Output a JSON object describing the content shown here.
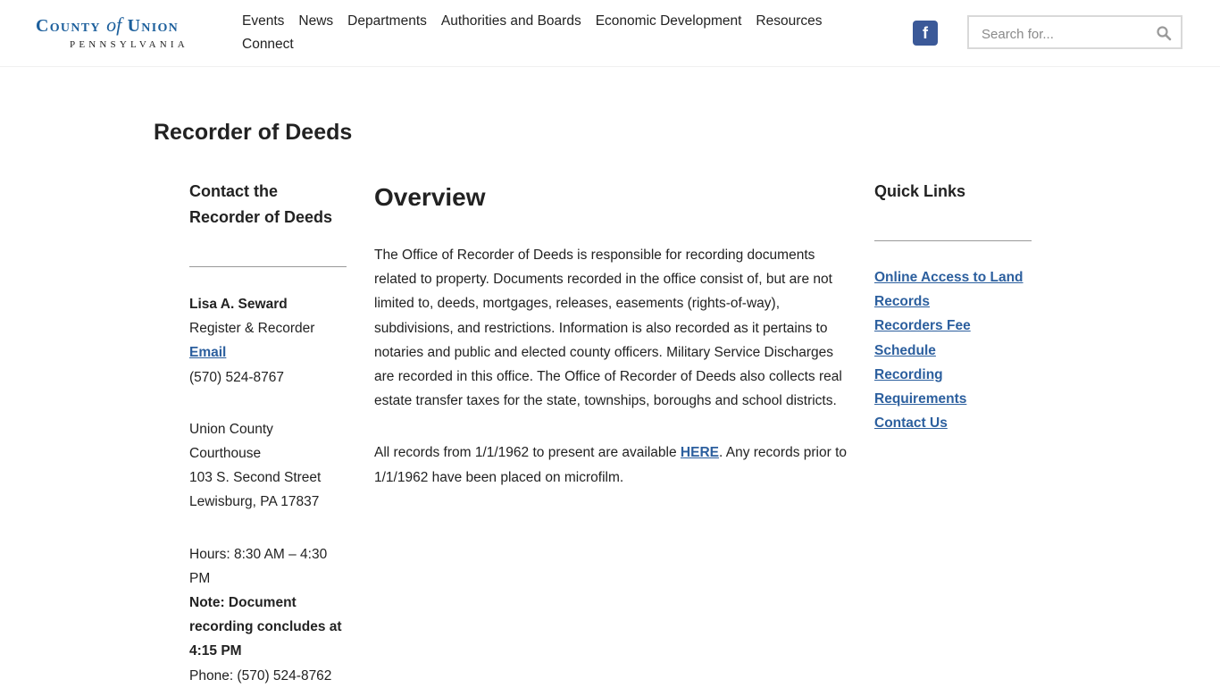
{
  "header": {
    "logo": {
      "county": "County",
      "of": "of",
      "union": "Union",
      "state": "PENNSYLVANIA"
    },
    "nav": [
      "Events",
      "News",
      "Departments",
      "Authorities and Boards",
      "Economic Development",
      "Resources",
      "Connect"
    ],
    "social": {
      "icon": "facebook-icon",
      "label": "f",
      "color": "#3b5998"
    },
    "search": {
      "placeholder": "Search for...",
      "icon": "search-icon"
    }
  },
  "page": {
    "title": "Recorder of Deeds"
  },
  "contact": {
    "heading": "Contact the Recorder of Deeds",
    "name": "Lisa A. Seward",
    "role": "Register & Recorder",
    "email_link": "Email",
    "phone_direct": "(570) 524-8767",
    "address": [
      "Union County Courthouse",
      "103 S. Second Street",
      "Lewisburg, PA 17837"
    ],
    "hours": "Hours: 8:30 AM – 4:30 PM",
    "note": "Note: Document recording concludes at 4:15 PM",
    "phone": "Phone: (570) 524-8762"
  },
  "overview": {
    "heading": "Overview",
    "paragraph1": "The Office of Recorder of Deeds is responsible for recording documents related to property. Documents recorded in the office consist of, but are not limited to, deeds, mortgages, releases, easements (rights-of-way), subdivisions, and restrictions. Information is also recorded as it pertains to notaries and public and elected county officers. Military Service Discharges are recorded in this office. The Office of Recorder of Deeds also collects real estate transfer taxes for the state, townships, boroughs and school districts.",
    "paragraph2_before": "All records from 1/1/1962 to present are available ",
    "paragraph2_link": "HERE",
    "paragraph2_after": ". Any records prior to 1/1/1962 have been placed on microfilm."
  },
  "quick_links": {
    "heading": "Quick Links",
    "items": [
      "Online Access to Land Records",
      "Recorders Fee Schedule",
      "Recording Requirements",
      "Contact Us"
    ]
  },
  "colors": {
    "brand": "#1c5f9c",
    "link": "#2c5f9e",
    "text": "#222222"
  }
}
